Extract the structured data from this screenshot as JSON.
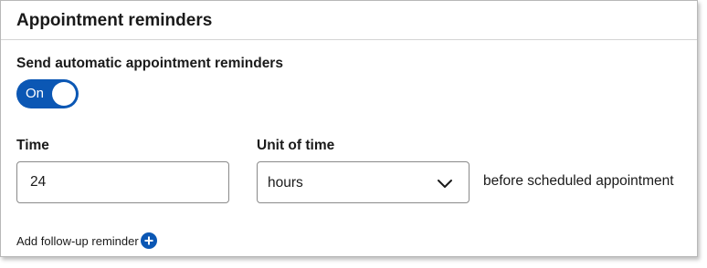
{
  "card": {
    "title": "Appointment reminders"
  },
  "auto_reminders": {
    "label": "Send automatic appointment reminders",
    "toggle_text": "On",
    "enabled": true
  },
  "time": {
    "label": "Time",
    "value": "24"
  },
  "unit": {
    "label": "Unit of time",
    "selected": "hours"
  },
  "suffix_text": "before scheduled appointment",
  "followup": {
    "label": "Add follow-up reminder"
  },
  "colors": {
    "accent": "#0b57b4",
    "border": "#8a8a8a"
  },
  "icons": {
    "dropdown": "chevron-down-icon",
    "add": "plus-circle-icon"
  }
}
